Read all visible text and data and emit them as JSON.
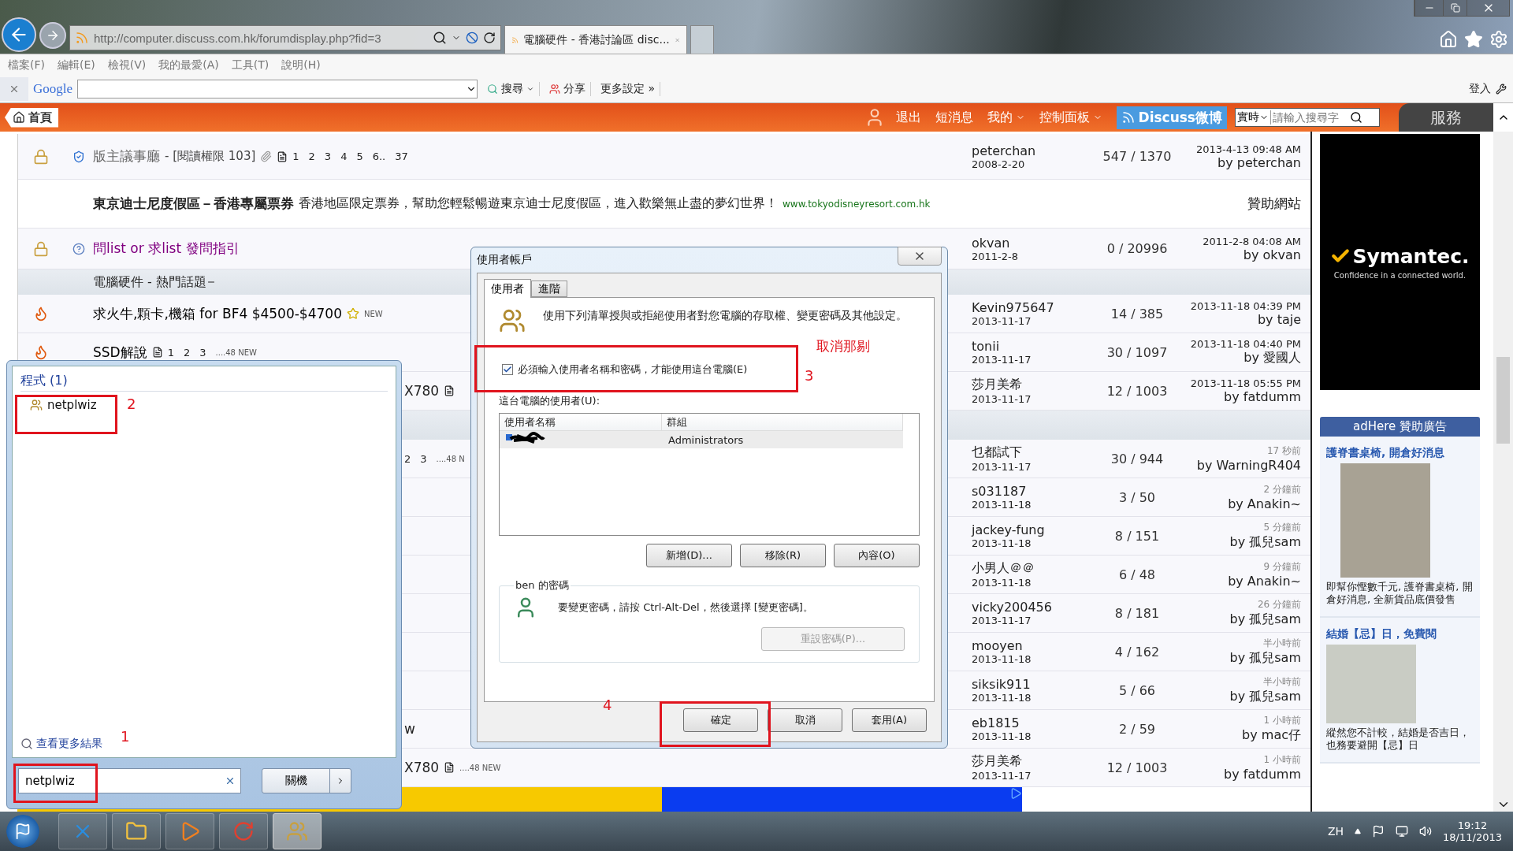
{
  "browser": {
    "address": "http://computer.discuss.com.hk/forumdisplay.php?fid=3",
    "tabs": [
      {
        "title": "電腦硬件 - 香港討論區 disc...",
        "selected": true
      }
    ],
    "menu": [
      "檔案(F)",
      "編輯(E)",
      "檢視(V)",
      "我的最愛(A)",
      "工具(T)",
      "說明(H)"
    ],
    "toolbar": {
      "brand": "Google",
      "search_button": "搜尋",
      "share": "分享",
      "more": "更多設定 »",
      "sign_in": "登入"
    }
  },
  "site_nav": {
    "home": "首頁",
    "links": [
      {
        "label": "退出",
        "dropdown": false
      },
      {
        "label": "短消息",
        "dropdown": false
      },
      {
        "label": "我的",
        "dropdown": true
      },
      {
        "label": "控制面板",
        "dropdown": true
      }
    ],
    "weibo": "Discuss微博",
    "search_scope": "實時",
    "search_placeholder": "請輸入搜尋字",
    "service_tab": "服務"
  },
  "forum_rows": [
    {
      "kind": "topic",
      "locked": true,
      "hot": false,
      "moderator": true,
      "help": false,
      "title": "版主議事廳",
      "color": "#666666",
      "extra": "- [閱讀權限 103]",
      "attachment": true,
      "pages": [
        "1",
        "2",
        "3",
        "4",
        "5",
        "6..",
        "37"
      ],
      "author": "peterchan",
      "date": "2008-2-20",
      "counts": "547 / 1370",
      "last_time": "2013-4-13 09:48 AM",
      "last_by": "by peterchan"
    },
    {
      "kind": "sponsor",
      "title": "東京迪士尼度假區－香港專屬票券",
      "text": "香港地區限定票券，幫助您輕鬆暢遊東京迪士尼度假區，進入歡樂無止盡的夢幻世界！",
      "link": "www.tokyodisneyresort.com.hk",
      "label": "贊助網站"
    },
    {
      "kind": "topic",
      "locked": true,
      "hot": false,
      "moderator": false,
      "help": true,
      "title": "問list or 求list 發問指引",
      "color": "#800080",
      "author": "okvan",
      "date": "2011-2-8",
      "counts": "0 / 20996",
      "last_time": "2011-2-8 04:08 AM",
      "last_by": "by okvan"
    },
    {
      "kind": "section",
      "title": "電腦硬件 - 熱門話題"
    },
    {
      "kind": "topic",
      "locked": false,
      "hot": true,
      "moderator": false,
      "help": false,
      "title": "求火牛,顆卡,機箱 for BF4 $4500-$4700",
      "color": "#000000",
      "new_badge": true,
      "tail": "NEW",
      "author": "Kevin975647",
      "date": "2013-11-17",
      "counts": "14 / 385",
      "last_time": "2013-11-18 04:39 PM",
      "last_by": "by taje"
    },
    {
      "kind": "topic",
      "locked": false,
      "hot": true,
      "moderator": false,
      "help": false,
      "title": "SSD解說",
      "color": "#000000",
      "pages": [
        "1",
        "2",
        "3"
      ],
      "tail": "....48 NEW",
      "author": "tonii",
      "date": "2013-11-17",
      "counts": "30 / 1097",
      "last_time": "2013-11-18 04:40 PM",
      "last_by": "by 愛國人"
    },
    {
      "kind": "partial",
      "fragment": "X780",
      "pages_icon": true,
      "author": "莎月美希",
      "date": "2013-11-17",
      "counts": "12 / 1003",
      "last_time": "2013-11-18 05:55 PM",
      "last_by": "by fatdumm"
    },
    {
      "kind": "divider"
    },
    {
      "kind": "partial",
      "pages": [
        "2",
        "3"
      ],
      "tail": "....48 N",
      "author": "乜都試下",
      "date": "2013-11-17",
      "counts": "30 / 944",
      "last_ago": "17 秒前",
      "last_by": "by WarningR404"
    },
    {
      "kind": "partial",
      "author": "s031187",
      "date": "2013-11-18",
      "counts": "3 / 50",
      "last_ago": "2 分鐘前",
      "last_by": "by Anakin~"
    },
    {
      "kind": "partial",
      "author": "jackey-fung",
      "date": "2013-11-18",
      "counts": "8 / 151",
      "last_ago": "5 分鐘前",
      "last_by": "by 孤兒sam"
    },
    {
      "kind": "partial",
      "author": "小男人＠＠",
      "date": "2013-11-18",
      "counts": "6 / 48",
      "last_ago": "9 分鐘前",
      "last_by": "by Anakin~"
    },
    {
      "kind": "partial",
      "author": "vicky200456",
      "date": "2013-11-17",
      "counts": "8 / 181",
      "last_ago": "26 分鐘前",
      "last_by": "by 孤兒sam"
    },
    {
      "kind": "partial",
      "author": "mooyen",
      "date": "2013-11-18",
      "counts": "4 / 162",
      "last_ago": "半小時前",
      "last_by": "by 孤兒sam"
    },
    {
      "kind": "partial",
      "author": "siksik911",
      "date": "2013-11-18",
      "counts": "5 / 66",
      "last_ago": "半小時前",
      "last_by": "by 孤兒sam"
    },
    {
      "kind": "partial",
      "fragment": "w",
      "author": "eb1815",
      "date": "2013-11-18",
      "counts": "2 / 59",
      "last_ago": "1 小時前",
      "last_by": "by mac仔"
    },
    {
      "kind": "partial",
      "fragment": "X780",
      "pages_icon": true,
      "tail": "....48 NEW",
      "author": "莎月美希",
      "date": "2013-11-17",
      "counts": "12 / 1003",
      "last_ago": "1 小時前",
      "last_by": "by fatdumm"
    }
  ],
  "symantec_ad": {
    "brand": "Symantec.",
    "tagline": "Confidence in a connected world."
  },
  "ads": {
    "header": "adHere 贊助廣告",
    "items": [
      {
        "title": "護脊書桌椅, 開倉好消息",
        "text": "即幫你慳數千元, 護脊書桌椅, 開倉好消息, 全新貨品底價發售"
      },
      {
        "title": "結婚【忌】日，免費閱",
        "text": "縱然您不計較，結婚是否吉日，也務要避開【忌】日"
      }
    ]
  },
  "start_menu": {
    "heading": "程式 (1)",
    "results": [
      {
        "label": "netplwiz",
        "highlighted": true,
        "annotation": "2"
      }
    ],
    "more_results": "查看更多結果",
    "search": {
      "value": "netplwiz",
      "highlighted": true,
      "annotation": "1"
    },
    "shutdown": "關機"
  },
  "dialog": {
    "title": "使用者帳戶",
    "tabs": [
      {
        "label": "使用者",
        "selected": true
      },
      {
        "label": "進階",
        "selected": false
      }
    ],
    "description": "使用下列清單授與或拒絕使用者對您電腦的存取權、變更密碼及其他設定。",
    "require_password": {
      "label": "必須輸入使用者名稱和密碼，才能使用這台電腦(E)",
      "checked": true,
      "highlighted": true,
      "annotation": "3",
      "note": "取消那剔"
    },
    "users_label": "這台電腦的使用者(U):",
    "columns": [
      "使用者名稱",
      "群組"
    ],
    "users": [
      {
        "group": "Administrators",
        "selected": true
      }
    ],
    "list_buttons": [
      "新增(D)...",
      "移除(R)",
      "內容(O)"
    ],
    "password_group": "ben 的密碼",
    "password_text": "要變更密碼，請按 Ctrl-Alt-Del，然後選擇 [變更密碼]。",
    "reset_button": {
      "label": "重設密碼(P)...",
      "disabled": true
    },
    "buttons": [
      {
        "label": "確定",
        "highlighted": true,
        "annotation": "4"
      },
      {
        "label": "取消",
        "highlighted": false
      },
      {
        "label": "套用(A)",
        "highlighted": false
      }
    ]
  },
  "taskbar": {
    "apps": [
      {
        "kind": "ie",
        "selected": false
      },
      {
        "kind": "explorer",
        "selected": false
      },
      {
        "kind": "media",
        "selected": false
      },
      {
        "kind": "chrome",
        "selected": false
      },
      {
        "kind": "users",
        "selected": true
      }
    ],
    "language": "ZH",
    "time": "19:12",
    "date": "18/11/2013"
  }
}
